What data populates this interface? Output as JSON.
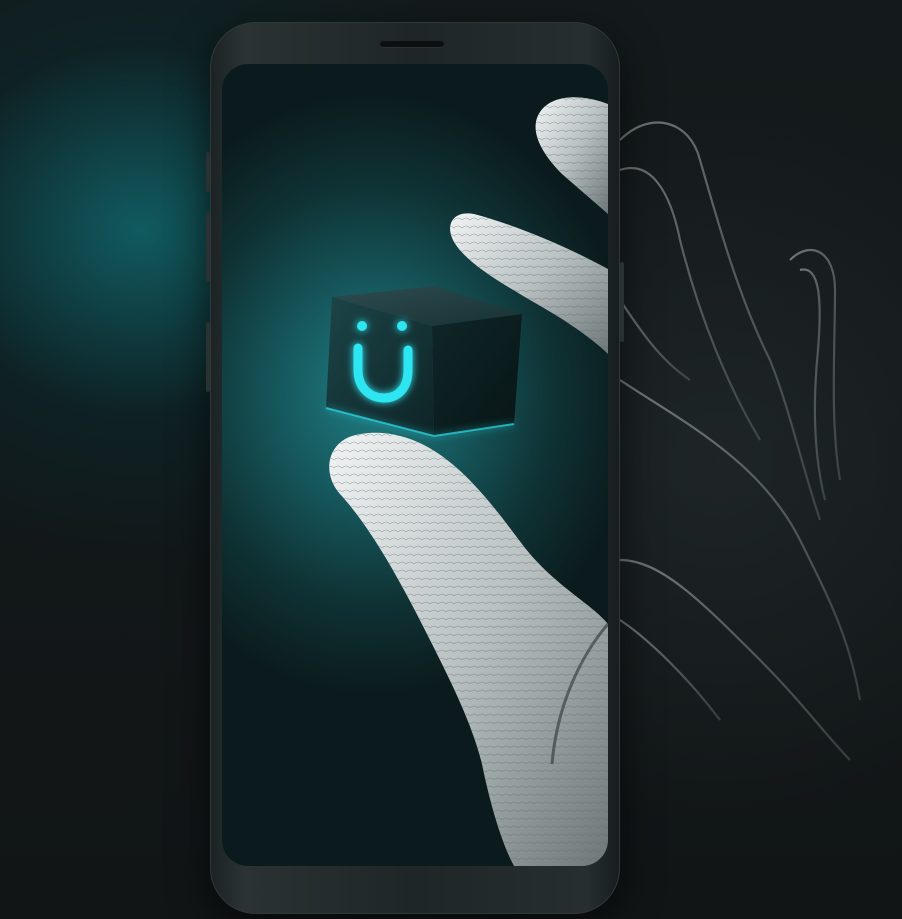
{
  "scene": {
    "description_icon": "hand-holding-cube",
    "logo_glyph": "ü",
    "accent_color": "#2ee6f2",
    "screen_color": "#1a6b70",
    "background_color": "#111617"
  }
}
